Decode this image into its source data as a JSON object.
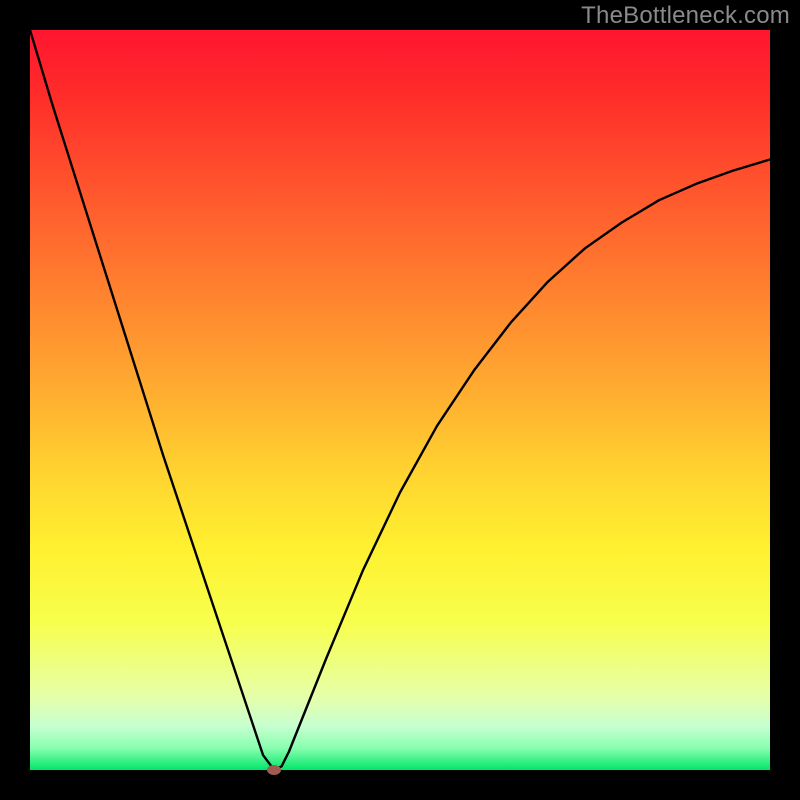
{
  "watermark": "TheBottleneck.com",
  "chart_data": {
    "type": "line",
    "title": "",
    "xlabel": "",
    "ylabel": "",
    "xlim": [
      0,
      100
    ],
    "ylim": [
      0,
      100
    ],
    "grid": false,
    "legend": false,
    "gradient": {
      "direction": "vertical",
      "stops": [
        {
          "pos": 0,
          "color": "#ff1530"
        },
        {
          "pos": 18,
          "color": "#ff4a2c"
        },
        {
          "pos": 38,
          "color": "#ff8a2f"
        },
        {
          "pos": 60,
          "color": "#ffd430"
        },
        {
          "pos": 80,
          "color": "#f7ff4c"
        },
        {
          "pos": 94,
          "color": "#c8ffd0"
        },
        {
          "pos": 100,
          "color": "#00e66a"
        }
      ]
    },
    "series": [
      {
        "name": "bottleneck-curve",
        "x": [
          0.0,
          3.0,
          6.0,
          9.0,
          12.0,
          15.0,
          18.0,
          21.0,
          24.0,
          27.0,
          30.0,
          31.5,
          33.0,
          34.0,
          35.0,
          40.0,
          45.0,
          50.0,
          55.0,
          60.0,
          65.0,
          70.0,
          75.0,
          80.0,
          85.0,
          90.0,
          95.0,
          100.0
        ],
        "y": [
          100.0,
          90.0,
          80.5,
          71.0,
          61.5,
          52.0,
          42.5,
          33.5,
          24.5,
          15.5,
          6.5,
          2.0,
          0.0,
          0.5,
          2.5,
          15.0,
          27.0,
          37.5,
          46.5,
          54.0,
          60.5,
          66.0,
          70.5,
          74.0,
          77.0,
          79.2,
          81.0,
          82.5
        ]
      }
    ],
    "cusp_marker": {
      "x": 33.0,
      "y": 0.0,
      "color": "#a15a52"
    }
  }
}
